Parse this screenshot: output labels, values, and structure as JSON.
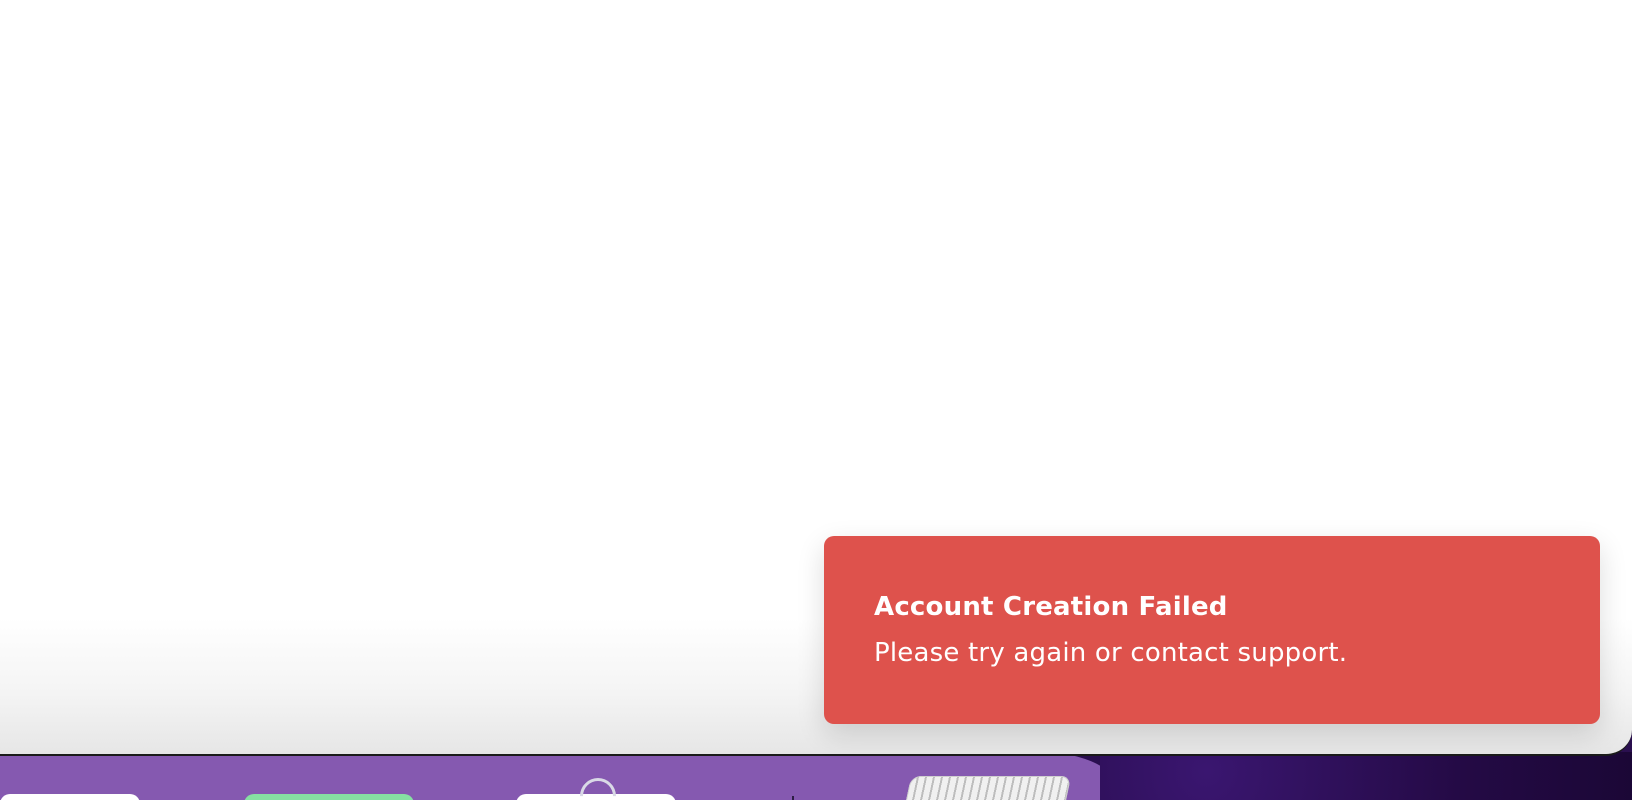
{
  "toast": {
    "title": "Account Creation Failed",
    "message": "Please try again or contact support.",
    "background_color": "#de524c",
    "text_color": "#ffffff"
  },
  "background": {
    "main_color": "#ffffff",
    "dock_band_color": "#8559b0",
    "wallpaper_color": "#240a45"
  }
}
